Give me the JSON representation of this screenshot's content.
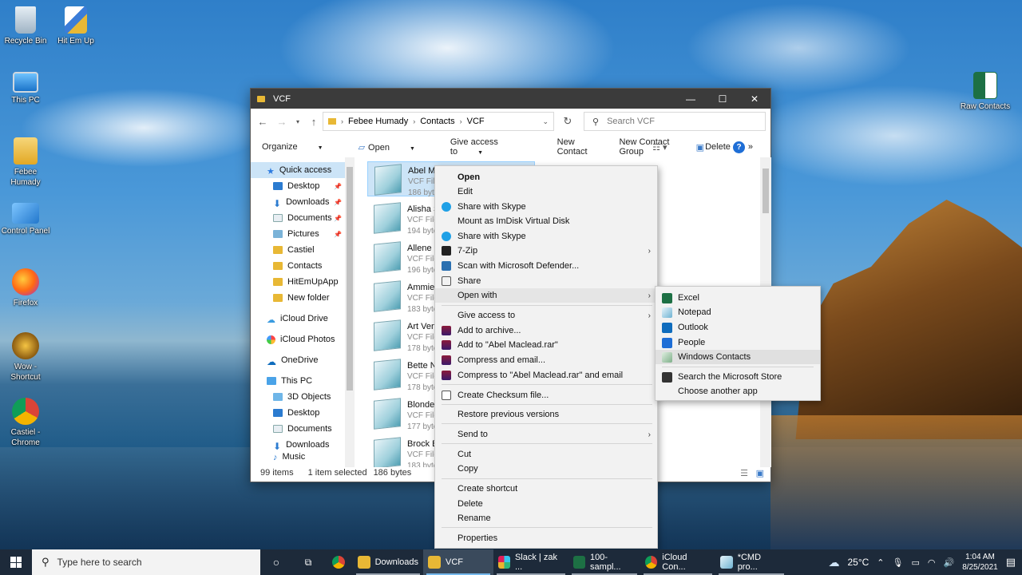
{
  "desktop": {
    "icons": [
      {
        "label": "Recycle Bin"
      },
      {
        "label": "Hit Em Up"
      },
      {
        "label": "This PC"
      },
      {
        "label": "Febee Humady"
      },
      {
        "label": "Control Panel"
      },
      {
        "label": "Firefox"
      },
      {
        "label": "Wow - Shortcut"
      },
      {
        "label": "Castiel - Chrome"
      },
      {
        "label": "Raw Contacts"
      }
    ]
  },
  "window": {
    "title": "VCF",
    "minimize": "—",
    "maximize": "☐",
    "close": "✕",
    "breadcrumb": [
      "Febee Humady",
      "Contacts",
      "VCF"
    ],
    "search_placeholder": "Search VCF",
    "toolbar": {
      "organize": "Organize",
      "open": "Open",
      "give_access": "Give access to",
      "new_contact": "New Contact",
      "new_contact_group": "New Contact Group",
      "delete": "Delete",
      "more": "»",
      "help": "?"
    },
    "nav": {
      "quick_access": "Quick access",
      "items": [
        "Desktop",
        "Downloads",
        "Documents",
        "Pictures",
        "Castiel",
        "Contacts",
        "HitEmUpApp",
        "New folder"
      ],
      "icloud_drive": "iCloud Drive",
      "icloud_photos": "iCloud Photos",
      "onedrive": "OneDrive",
      "this_pc": "This PC",
      "pc_items": [
        "3D Objects",
        "Desktop",
        "Documents",
        "Downloads",
        "Music"
      ]
    },
    "files": [
      {
        "name": "Abel Maclead",
        "type": "VCF File",
        "size": "186 bytes"
      },
      {
        "name": "Alisha Slusarski",
        "type": "VCF File",
        "size": "194 bytes"
      },
      {
        "name": "Allene Iturbide",
        "type": "VCF File",
        "size": "196 bytes"
      },
      {
        "name": "Ammie Corrio",
        "type": "VCF File",
        "size": "183 bytes"
      },
      {
        "name": "Art Venere",
        "type": "VCF File",
        "size": "178 bytes"
      },
      {
        "name": "Bette Nicka",
        "type": "VCF File",
        "size": "178 bytes"
      },
      {
        "name": "Blondell Pugh",
        "type": "VCF File",
        "size": "177 bytes"
      },
      {
        "name": "Brock Bolognia",
        "type": "VCF File",
        "size": "183 bytes"
      }
    ],
    "status": {
      "count": "99 items",
      "selected": "1 item selected",
      "size": "186 bytes"
    }
  },
  "context_menu": {
    "items": [
      "Open",
      "Edit",
      "Share with Skype",
      "Mount as ImDisk Virtual Disk",
      "Share with Skype",
      "7-Zip",
      "Scan with Microsoft Defender...",
      "Share",
      "Open with",
      "Give access to",
      "Add to archive...",
      "Add to \"Abel Maclead.rar\"",
      "Compress and email...",
      "Compress to \"Abel Maclead.rar\" and email",
      "Create Checksum file...",
      "Restore previous versions",
      "Send to",
      "Cut",
      "Copy",
      "Create shortcut",
      "Delete",
      "Rename",
      "Properties"
    ]
  },
  "open_with_menu": {
    "items": [
      "Excel",
      "Notepad",
      "Outlook",
      "People",
      "Windows Contacts",
      "Search the Microsoft Store",
      "Choose another app"
    ]
  },
  "taskbar": {
    "search_placeholder": "Type here to search",
    "apps": [
      "Downloads",
      "VCF",
      "Slack | zak ...",
      "100-sampl...",
      "iCloud Con...",
      "*CMD pro..."
    ],
    "weather": "25°C",
    "time": "1:04 AM",
    "date": "8/25/2021"
  }
}
